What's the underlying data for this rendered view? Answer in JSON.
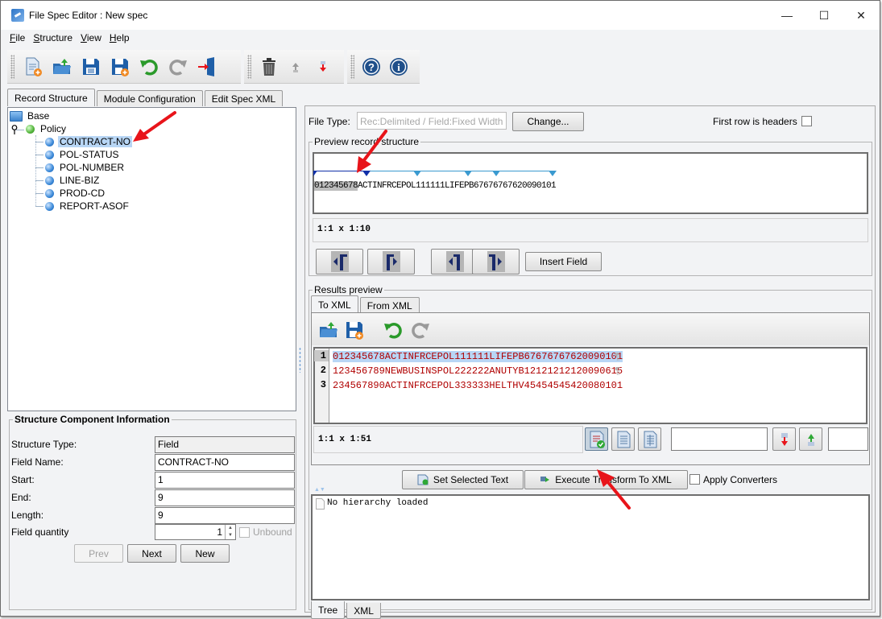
{
  "window": {
    "title": "File Spec Editor : New spec",
    "controls": {
      "minimize": "—",
      "maximize": "☐",
      "close": "✕"
    }
  },
  "menu": [
    {
      "label": "File",
      "mnemonic": "F",
      "rest": "ile"
    },
    {
      "label": "Structure",
      "mnemonic": "S",
      "rest": "tructure"
    },
    {
      "label": "View",
      "mnemonic": "V",
      "rest": "iew"
    },
    {
      "label": "Help",
      "mnemonic": "H",
      "rest": "elp"
    }
  ],
  "toolbar": {
    "groups": [
      [
        "new-spec-icon",
        "open-icon",
        "save-icon",
        "save-as-icon",
        "undo-icon",
        "redo-icon",
        "exit-icon"
      ],
      [
        "delete-icon",
        "move-up-icon",
        "move-down-icon"
      ],
      [
        "help-icon",
        "info-icon"
      ]
    ]
  },
  "main_tabs": [
    "Record Structure",
    "Module Configuration",
    "Edit Spec XML"
  ],
  "active_main_tab": "Record Structure",
  "tree": {
    "root": "Base",
    "record": "Policy",
    "fields": [
      "CONTRACT-NO",
      "POL-STATUS",
      "POL-NUMBER",
      "LINE-BIZ",
      "PROD-CD",
      "REPORT-ASOF"
    ],
    "selected": "CONTRACT-NO"
  },
  "structure_info": {
    "title": "Structure Component Information",
    "rows": [
      {
        "label": "Structure Type:",
        "value": "Field"
      },
      {
        "label": "Field Name:",
        "value": "CONTRACT-NO"
      },
      {
        "label": "Start:",
        "value": "1"
      },
      {
        "label": "End:",
        "value": "9"
      },
      {
        "label": "Length:",
        "value": "9"
      }
    ],
    "quantity_label": "Field quantity",
    "quantity_value": "1",
    "unbound_label": "Unbound",
    "unbound_checked": false,
    "buttons": {
      "prev": "Prev",
      "next": "Next",
      "new": "New"
    }
  },
  "file_type": {
    "label": "File Type:",
    "value": "Rec:Delimited / Field:Fixed Width",
    "change_button": "Change...",
    "first_row_headers_label": "First row is headers",
    "first_row_headers_checked": false
  },
  "preview": {
    "title": "Preview record structure",
    "selected_text": "012345678",
    "rest_text": "ACTINFRCEPOL111111LIFEPB67676767620090101",
    "position": "1:1 x 1:10",
    "insert_field_button": "Insert Field",
    "nav_buttons": [
      "shift-start-left-icon",
      "shift-start-right-icon",
      "shift-end-left-icon",
      "shift-end-right-icon"
    ]
  },
  "results": {
    "title": "Results preview",
    "tabs": [
      "To XML",
      "From XML"
    ],
    "active_tab": "To XML",
    "editor_toolbar": [
      "open-icon",
      "save-as-icon",
      "undo-icon",
      "redo-icon"
    ],
    "lines": [
      {
        "num": "1",
        "text": "012345678ACTINFRCEPOL111111LIFEPB67676767620090101",
        "pilcrow": true
      },
      {
        "num": "2",
        "text": "123456789NEWBUSINSPOL222222ANUTYB12121212120090615",
        "pilcrow": true
      },
      {
        "num": "3",
        "text": "234567890ACTINFRCEPOL333333HELTHV45454545420080101",
        "pilcrow": false
      }
    ],
    "position": "1:1 x 1:51",
    "set_selected_text_button": "Set Selected Text",
    "execute_button": "Execute Transform To XML",
    "apply_converters_label": "Apply Converters",
    "apply_converters_checked": false,
    "search_value": "",
    "hierarchy_text": "No hierarchy loaded",
    "bottom_tabs": [
      "Tree",
      "XML"
    ],
    "active_bottom_tab": "Tree"
  },
  "colors": {
    "selection": "#b8d6f5",
    "code_text": "#b00000",
    "annotation_arrow": "#e8141a",
    "ruler": "#3a9ad0"
  }
}
